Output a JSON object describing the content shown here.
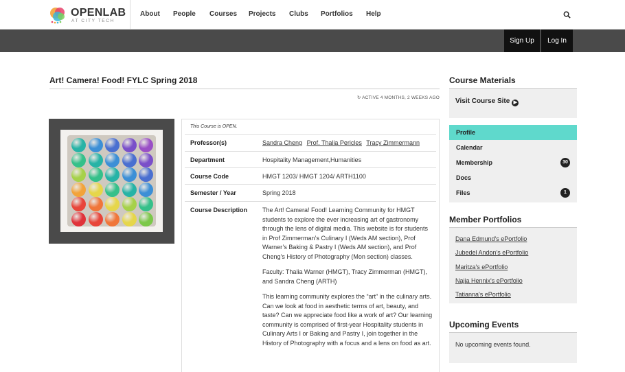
{
  "brand": {
    "name": "OPENLAB",
    "tagline": "AT CITY TECH"
  },
  "nav": {
    "items": [
      "About",
      "People",
      "Courses",
      "Projects",
      "Clubs",
      "Portfolios",
      "Help"
    ]
  },
  "account": {
    "signup_label": "Sign Up",
    "login_label": "Log In"
  },
  "course": {
    "title": "Art! Camera! Food! FYLC Spring 2018",
    "activity": "ACTIVE 4 MONTHS, 2 WEEKS AGO",
    "open_note": "This Course is OPEN.",
    "professors_label": "Professor(s)",
    "professors": [
      "Sandra Cheng",
      "Prof. Thalia Pericles",
      "Tracy Zimmermann"
    ],
    "department_label": "Department",
    "department": "Hospitality Management,Humanities",
    "code_label": "Course Code",
    "code": "HMGT 1203/ HMGT 1204/ ARTH1100",
    "semester_label": "Semester / Year",
    "semester": "Spring 2018",
    "description_label": "Course Description",
    "description": [
      "The Art! Camera! Food! Learning Community for HMGT students to explore the ever increasing art of gastronomy through the lens of digital media. This website is for students in Prof Zimmerman’s Culinary I (Weds AM section), Prof Warner’s Baking & Pastry I (Weds AM section), and Prof Cheng’s History of Photography (Mon section) classes.",
      "Faculty: Thalia Warner (HMGT), Tracy Zimmerman (HMGT), and Sandra Cheng (ARTH)",
      "This learning community explores the “art” in the culinary arts. Can we look at food in aesthetic terms of art, beauty, and taste? Can we appreciate food like a work of art? Our learning community is comprised of first-year Hospitality students in Culinary Arts I or Baking and Pastry I, join together in the History of Photography with a focus and a lens on food as art."
    ]
  },
  "sidebar": {
    "materials_heading": "Course Materials",
    "visit_label": "Visit Course Site",
    "menu": [
      {
        "label": "Profile",
        "badge": ""
      },
      {
        "label": "Calendar",
        "badge": ""
      },
      {
        "label": "Membership",
        "badge": "30"
      },
      {
        "label": "Docs",
        "badge": ""
      },
      {
        "label": "Files",
        "badge": "1"
      }
    ],
    "portfolios_heading": "Member Portfolios",
    "portfolios": [
      "Dana Edmund's ePortfolio",
      "Jubedel Andon's ePortfolio",
      "Maritza's ePortfolio",
      "Najja Hennix's ePortfolio",
      "Tatianna's ePortfolio"
    ],
    "events_heading": "Upcoming Events",
    "events_empty": "No upcoming events found."
  },
  "colors": {
    "accent": "#5fd9cc",
    "dark_bar": "#4a4a4a",
    "button": "#111111"
  }
}
